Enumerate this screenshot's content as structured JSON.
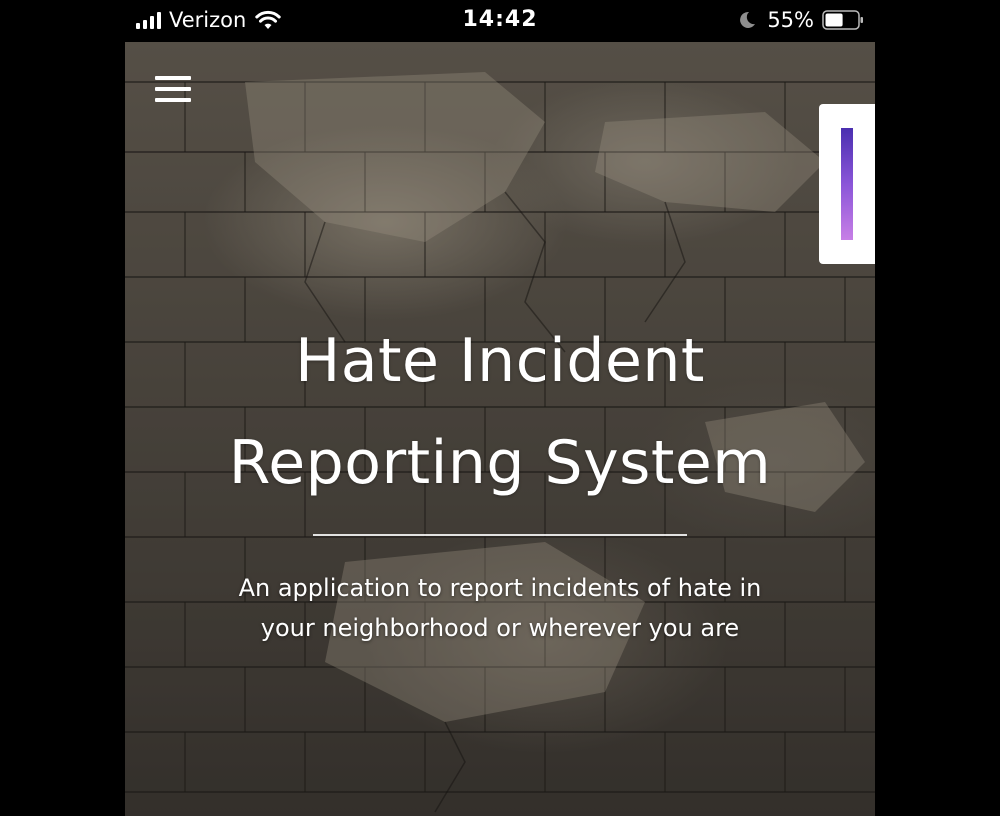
{
  "status_bar": {
    "carrier": "Verizon",
    "time": "14:42",
    "battery_percent": "55%",
    "battery_level": 0.55,
    "signal_bars": 4,
    "icons": [
      "signal-icon",
      "wifi-icon",
      "moon-icon",
      "battery-icon"
    ]
  },
  "header": {
    "menu_icon": "hamburger-menu-icon"
  },
  "hero": {
    "title_line1": "Hate Incident",
    "title_line2": "Reporting System",
    "subtitle_line1": "An application to report incidents of hate in",
    "subtitle_line2": "your neighborhood or wherever you are"
  },
  "side_panel": {
    "accent_colors": [
      "#4a2fb0",
      "#c77fe6"
    ]
  },
  "colors": {
    "text": "#ffffff",
    "background": "#000000"
  }
}
